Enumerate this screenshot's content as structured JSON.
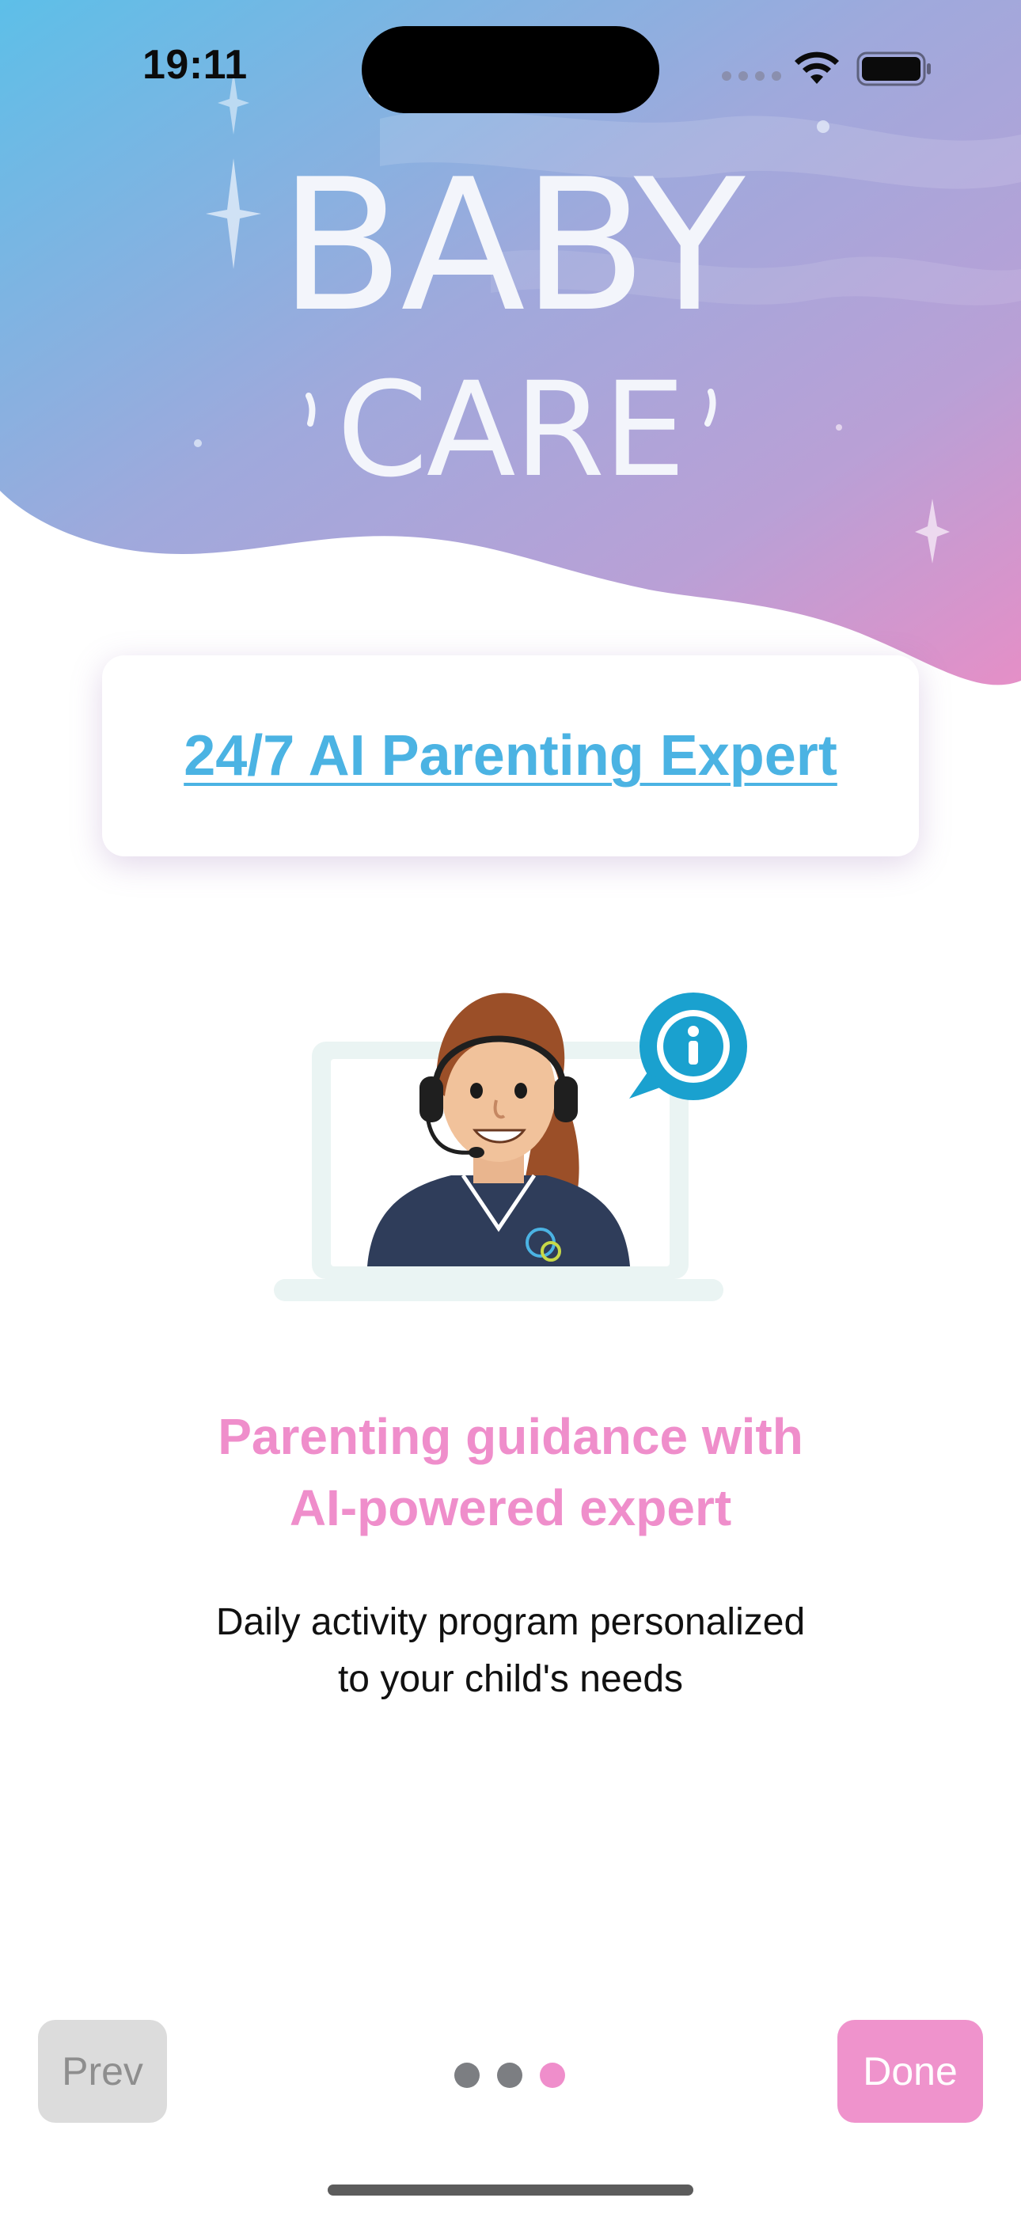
{
  "status_bar": {
    "time": "19:11"
  },
  "logo": {
    "line1": "BABY",
    "line2": "CARE"
  },
  "headline": {
    "link_text": "24/7 AI Parenting Expert"
  },
  "content": {
    "title_line1": "Parenting guidance with",
    "title_line2": "AI-powered expert",
    "subtitle_line1": "Daily activity program personalized",
    "subtitle_line2": "to your child's needs"
  },
  "navigation": {
    "prev_label": "Prev",
    "done_label": "Done",
    "page_count": 3,
    "current_page": 3
  },
  "icons": {
    "wifi": "wifi-icon",
    "battery": "battery-icon",
    "info": "info-icon",
    "support_agent": "support-agent-illustration"
  },
  "colors": {
    "accent_pink": "#ef8ecb",
    "accent_blue": "#4bb3e3",
    "prev_button_bg": "#dcdcdc",
    "done_button_bg": "#ef93cc"
  }
}
